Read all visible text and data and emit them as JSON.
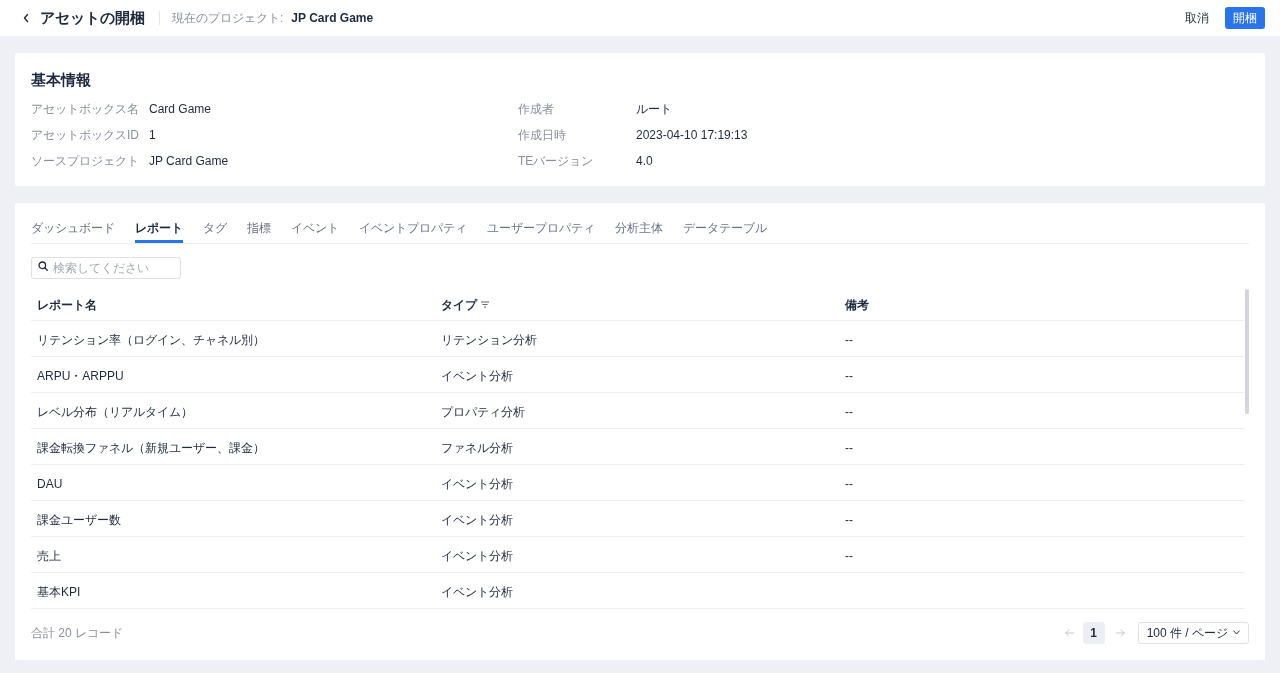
{
  "header": {
    "title": "アセットの開梱",
    "project_label": "現在のプロジェクト:",
    "project_name": "JP Card Game",
    "buttons": [
      {
        "label": "取消",
        "kind": "text"
      },
      {
        "label": "開梱",
        "kind": "primary"
      }
    ]
  },
  "basic_info": {
    "title": "基本情報",
    "fields": [
      {
        "label": "アセットボックス名",
        "value": "Card Game"
      },
      {
        "label": "作成者",
        "value": "ルート"
      },
      {
        "label": "アセットボックスID",
        "value": "1"
      },
      {
        "label": "作成日時",
        "value": "2023-04-10 17:19:13"
      },
      {
        "label": "ソースプロジェクト",
        "value": "JP Card Game"
      },
      {
        "label": "TEバージョン",
        "value": "4.0"
      }
    ]
  },
  "tabs": [
    {
      "label": "ダッシュボード",
      "selected": false
    },
    {
      "label": "レポート",
      "selected": true
    },
    {
      "label": "タグ",
      "selected": false
    },
    {
      "label": "指標",
      "selected": false
    },
    {
      "label": "イベント",
      "selected": false
    },
    {
      "label": "イベントプロパティ",
      "selected": false
    },
    {
      "label": "ユーザープロパティ",
      "selected": false
    },
    {
      "label": "分析主体",
      "selected": false
    },
    {
      "label": "データテーブル",
      "selected": false
    }
  ],
  "search": {
    "placeholder": "検索してください"
  },
  "table": {
    "columns": [
      {
        "label": "レポート名",
        "filter": false
      },
      {
        "label": "タイプ",
        "filter": true
      },
      {
        "label": "備考",
        "filter": false
      }
    ],
    "rows": [
      {
        "cells": [
          "リテンション率（ログイン、チャネル別）",
          "リテンション分析",
          "--"
        ]
      },
      {
        "cells": [
          "ARPU・ARPPU",
          "イベント分析",
          "--"
        ]
      },
      {
        "cells": [
          "レベル分布（リアルタイム）",
          "プロパティ分析",
          "--"
        ]
      },
      {
        "cells": [
          "課金転換ファネル（新規ユーザー、課金）",
          "ファネル分析",
          "--"
        ]
      },
      {
        "cells": [
          "DAU",
          "イベント分析",
          "--"
        ]
      },
      {
        "cells": [
          "課金ユーザー数",
          "イベント分析",
          "--"
        ]
      },
      {
        "cells": [
          "売上",
          "イベント分析",
          "--"
        ]
      },
      {
        "cells": [
          "基本KPI",
          "イベント分析"
        ]
      }
    ]
  },
  "footer": {
    "total": "合計 20 レコード",
    "pagination": {
      "prev": {
        "disabled": true
      },
      "pages": [
        {
          "label": "1",
          "selected": true
        }
      ],
      "next": {
        "disabled": true
      },
      "page_size": "100 件 / ページ"
    }
  }
}
